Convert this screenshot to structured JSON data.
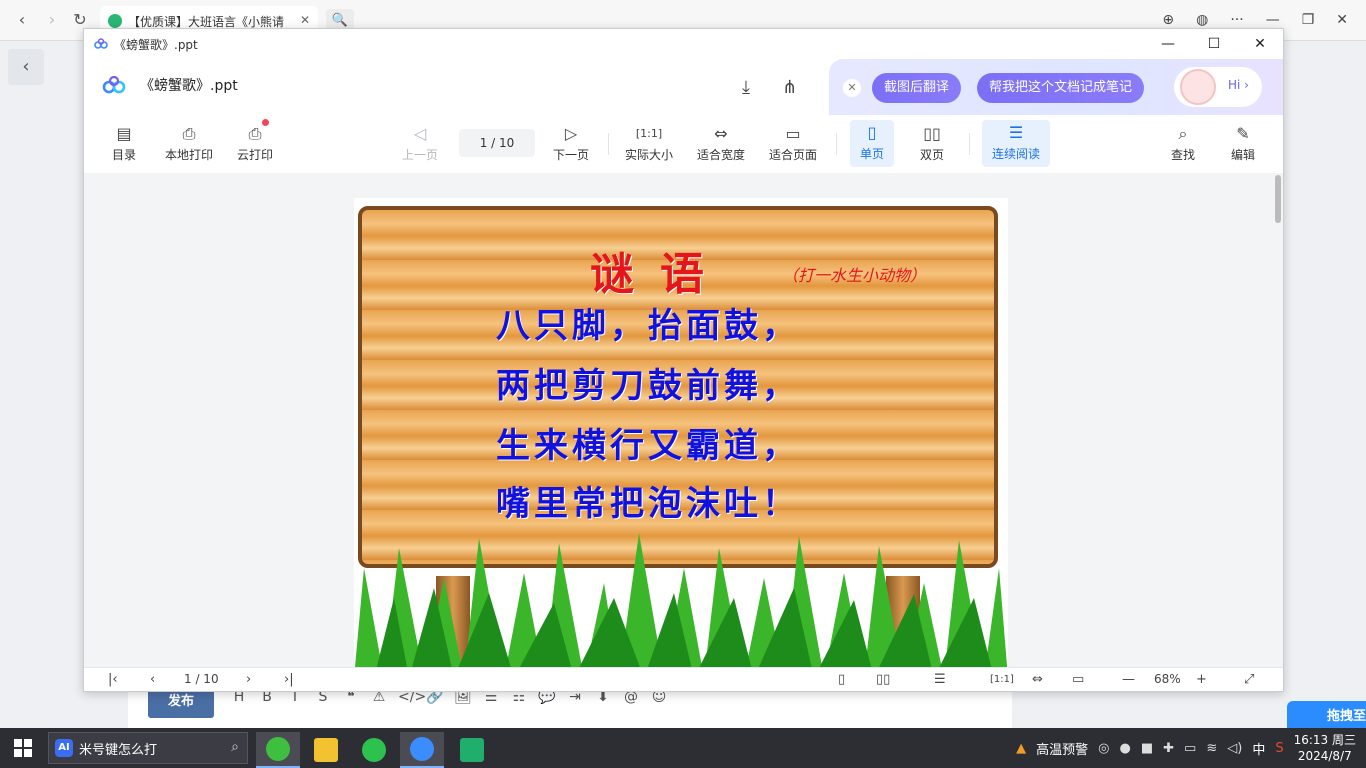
{
  "browser": {
    "tab_title": "【优质课】大班语言《小熊请",
    "tab_close": "✕",
    "search_glyph": "🔍"
  },
  "background_page": {
    "back_glyph": "‹",
    "publish_label": "发布",
    "editor_tools": [
      "H",
      "B",
      "I",
      "S",
      "❝",
      "⚠",
      "</>",
      "🔗",
      "🖼",
      "☰",
      "☷",
      "💬",
      "⇥",
      "⬇",
      "@",
      "☺"
    ],
    "baidu_badge": "拖拽至"
  },
  "viewer": {
    "window_title": "《螃蟹歌》.ppt",
    "window_controls": [
      "—",
      "☐",
      "✕"
    ],
    "doc_title": "《螃蟹歌》.ppt",
    "ai_chips": [
      "截图后翻译",
      "帮我把这个文档记成笔记"
    ],
    "ai_close": "✕",
    "ai_greeting": "Hi",
    "toolbar": {
      "toc": "目录",
      "local_print": "本地打印",
      "cloud_print": "云打印",
      "prev_page": "上一页",
      "page_indicator": "1 / 10",
      "next_page": "下一页",
      "actual_size": "实际大小",
      "fit_width": "适合宽度",
      "fit_page": "适合页面",
      "single_page": "单页",
      "double_page": "双页",
      "continuous": "连续阅读",
      "find": "查找",
      "edit": "编辑"
    },
    "slide": {
      "title": "谜语",
      "subtitle": "（打一水生小动物）",
      "lines": [
        "八只脚，抬面鼓，",
        "两把剪刀鼓前舞，",
        "生来横行又霸道，",
        "嘴里常把泡沫吐！"
      ]
    },
    "bottombar": {
      "page_indicator": "1 / 10",
      "zoom": "68%",
      "zoom_out": "—",
      "zoom_in": "+"
    }
  },
  "taskbar": {
    "search_text": "米号键怎么打",
    "ai_label": "AI",
    "weather": "高温预警",
    "ime": "中",
    "time": "16:13 周三",
    "date": "2024/8/7"
  },
  "colors": {
    "accent": "#1a73e8",
    "ai_chip": "#7d6ff5",
    "slide_title": "#e4161b",
    "slide_text": "#1212e0"
  }
}
